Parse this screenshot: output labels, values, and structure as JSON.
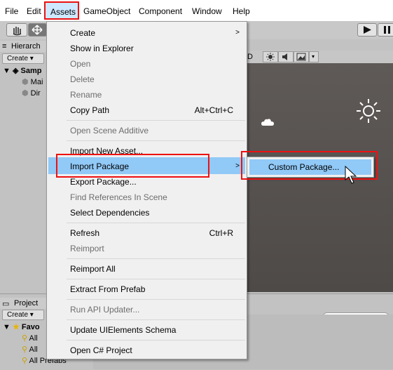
{
  "menubar": {
    "items": [
      "File",
      "Edit",
      "Assets",
      "GameObject",
      "Component",
      "Window",
      "Help"
    ],
    "active": "Assets"
  },
  "hierarchy": {
    "tab": "Hierarch",
    "create": "Create ▾",
    "rows": [
      "Samp",
      "Mai",
      "Dir"
    ]
  },
  "project": {
    "tab": "Project",
    "create": "Create ▾",
    "rows": [
      "Favo",
      "All",
      "All",
      "All Prefabs"
    ]
  },
  "menu": {
    "items": [
      {
        "label": "Create",
        "submenu": true
      },
      {
        "label": "Show in Explorer"
      },
      {
        "label": "Open",
        "disabled": true
      },
      {
        "label": "Delete",
        "disabled": true
      },
      {
        "label": "Rename",
        "disabled": true
      },
      {
        "label": "Copy Path",
        "shortcut": "Alt+Ctrl+C"
      },
      {
        "label": "Open Scene Additive",
        "disabled": true
      },
      {
        "label": "Import New Asset..."
      },
      {
        "label": "Import Package",
        "submenu": true,
        "highlighted": true
      },
      {
        "label": "Export Package..."
      },
      {
        "label": "Find References In Scene",
        "disabled": true
      },
      {
        "label": "Select Dependencies"
      },
      {
        "label": "Refresh",
        "shortcut": "Ctrl+R"
      },
      {
        "label": "Reimport",
        "disabled": true
      },
      {
        "label": "Reimport All"
      },
      {
        "label": "Extract From Prefab"
      },
      {
        "label": "Run API Updater...",
        "disabled": true
      },
      {
        "label": "Update UIElements Schema"
      },
      {
        "label": "Open C# Project"
      }
    ]
  },
  "submenu": {
    "item": "Custom Package..."
  },
  "icons": [
    "hand-icon",
    "move-icon",
    "play-icon",
    "pause-icon",
    "sun-icon",
    "cloud-icon",
    "star-icon",
    "search-icon"
  ],
  "colors": {
    "highlight": "#91c9f7",
    "annotation": "#ee1111",
    "scene": "#5a5654"
  }
}
